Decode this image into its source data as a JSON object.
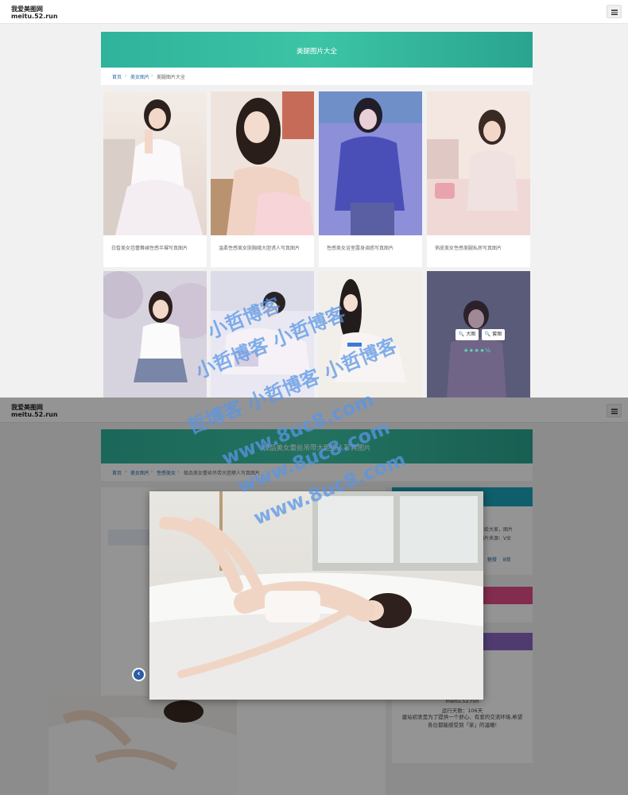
{
  "site": {
    "name": "我爱美图网",
    "domain": "meitu.52.run"
  },
  "list_page": {
    "banner_title": "美腿图片大全",
    "breadcrumb": [
      "首页",
      "美女图片",
      "美腿图片大全"
    ],
    "cards": [
      {
        "title": "白皙美女芭蕾舞裙性感半裸写真图片"
      },
      {
        "title": "温柔性感美女肤胸峨大胆诱人写真图片"
      },
      {
        "title": "性感美女浴室露身调惑写真图片"
      },
      {
        "title": "俏皮美女性感美腿私房写真图片"
      },
      {
        "title": ""
      },
      {
        "title": ""
      },
      {
        "title": ""
      },
      {
        "title": ""
      }
    ],
    "hover_actions": {
      "big": "大图",
      "gallery": "套图",
      "stars": "★★★★½"
    }
  },
  "detail_page": {
    "banner_title": "极品美女蕾丝吊带大胆撩人写真图片",
    "breadcrumb": [
      "首页",
      "美女图片",
      "性感美女",
      "极品美女蕾丝吊带大胆撩人写真图片"
    ],
    "sidebar": {
      "intro_lines": [
        "享给大家，图片",
        "图片来源：V女"
      ],
      "tags": [
        "魅餐",
        "8就"
      ],
      "site": "meitu.52.run",
      "days": "运行天数：106天",
      "message_lines": [
        "建站初衷是为了提供一个舒心、有爱的交流环境,希望",
        "各位都能感受到「家」的温暖!"
      ]
    },
    "lightbox": {
      "prev_icon": "‹"
    }
  },
  "watermark": {
    "lines": [
      "小哲博客",
      "小哲博客 小哲博客",
      "哲博客 小哲博客 小哲博客",
      "www.8uc8.com",
      "www.8uc8.com",
      "www.8uc8.com"
    ]
  },
  "colors": {
    "banner": "#2fb39b",
    "link": "#2a6aa6",
    "side_head_1": "#1aa2b8",
    "side_head_2": "#e04c87",
    "side_head_3": "#8a66c2"
  }
}
